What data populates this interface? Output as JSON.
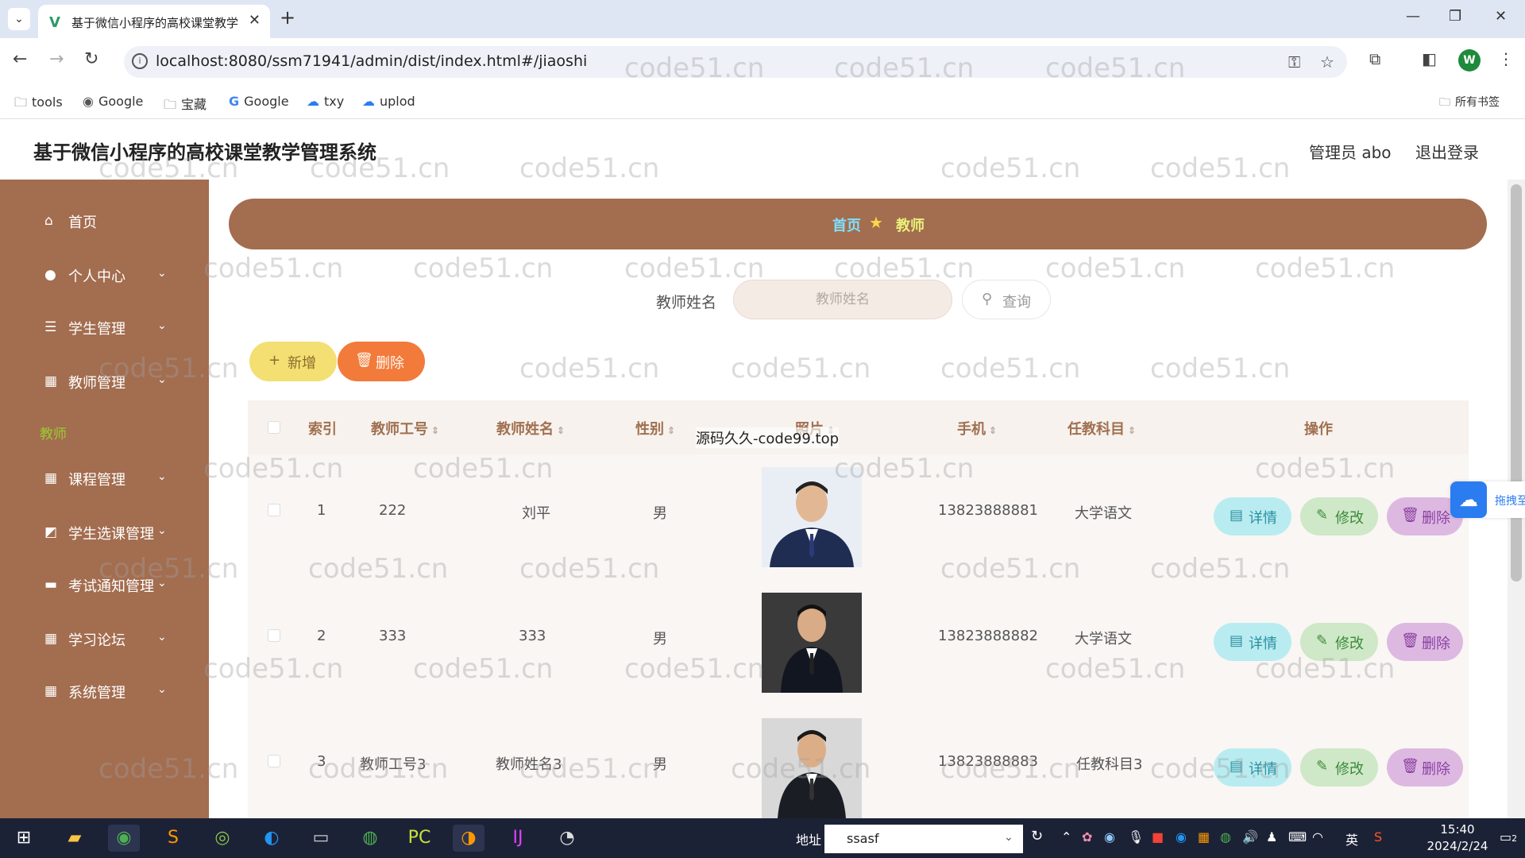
{
  "browser": {
    "tab_title": "基于微信小程序的高校课堂教学",
    "url": "localhost:8080/ssm71941/admin/dist/index.html#/jiaoshi",
    "bookmarks": [
      {
        "label": "tools",
        "icon": "folder-icon"
      },
      {
        "label": "Google",
        "icon": "globe-icon"
      },
      {
        "label": "宝藏",
        "icon": "folder-icon"
      },
      {
        "label": "Google",
        "icon": "google-icon"
      },
      {
        "label": "txy",
        "icon": "cloud-icon"
      },
      {
        "label": "uplod",
        "icon": "cloud-icon"
      }
    ],
    "all_bookmarks": "所有书签",
    "profile_initial": "W"
  },
  "header": {
    "title": "基于微信小程序的高校课堂教学管理系统",
    "admin_label": "管理员 abo",
    "logout": "退出登录"
  },
  "sidebar": {
    "items": [
      {
        "label": "首页",
        "icon": "home-icon",
        "has_arrow": false
      },
      {
        "label": "个人中心",
        "icon": "user-icon",
        "has_arrow": true
      },
      {
        "label": "学生管理",
        "icon": "list-icon",
        "has_arrow": true
      },
      {
        "label": "教师管理",
        "icon": "grid-icon",
        "has_arrow": true
      },
      {
        "label": "课程管理",
        "icon": "grid-icon",
        "has_arrow": true
      },
      {
        "label": "学生选课管理",
        "icon": "chart-icon",
        "has_arrow": true
      },
      {
        "label": "考试通知管理",
        "icon": "printer-icon",
        "has_arrow": true
      },
      {
        "label": "学习论坛",
        "icon": "grid-icon",
        "has_arrow": true
      },
      {
        "label": "系统管理",
        "icon": "grid-icon",
        "has_arrow": true
      }
    ],
    "active_sub": "教师"
  },
  "breadcrumb": {
    "home": "首页",
    "current": "教师"
  },
  "search": {
    "label": "教师姓名",
    "placeholder": "教师姓名",
    "button": "查询"
  },
  "actions": {
    "add": "新增",
    "delete": "删除"
  },
  "table": {
    "headers": [
      "索引",
      "教师工号",
      "教师姓名",
      "性别",
      "照片",
      "手机",
      "任教科目",
      "操作"
    ],
    "rows": [
      {
        "index": "1",
        "id": "222",
        "name": "刘平",
        "gender": "男",
        "phone": "13823888881",
        "subject": "大学语文"
      },
      {
        "index": "2",
        "id": "333",
        "name": "333",
        "gender": "男",
        "phone": "13823888882",
        "subject": "大学语文"
      },
      {
        "index": "3",
        "id": "教师工号3",
        "name": "教师姓名3",
        "gender": "男",
        "phone": "13823888883",
        "subject": "任教科目3"
      }
    ],
    "row_actions": {
      "detail": "详情",
      "edit": "修改",
      "delete": "删除"
    }
  },
  "tooltip": "源码久久-code99.top",
  "float_widget": "拖拽至",
  "watermark": "code51.cn",
  "taskbar": {
    "addr_label": "地址",
    "addr_value": "ssasf",
    "lang": "英",
    "time": "15:40",
    "date": "2024/2/24",
    "notif_count": "2"
  }
}
